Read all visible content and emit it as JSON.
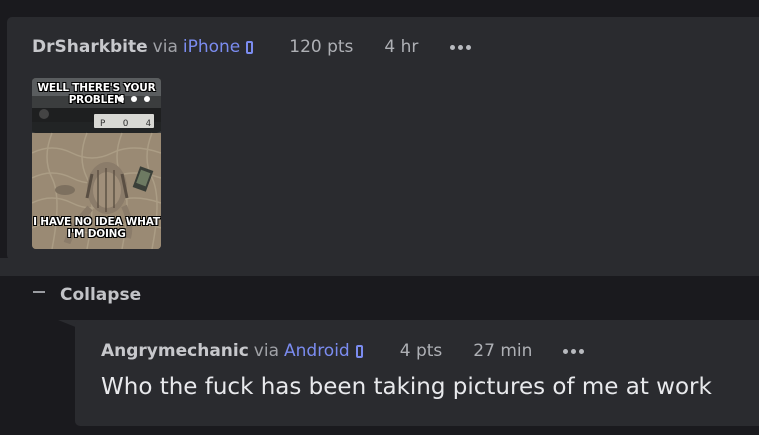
{
  "post": {
    "author": "DrSharkbite",
    "via": "via",
    "platform": "iPhone",
    "platform_icon": "phone-icon",
    "points": "120 pts",
    "time": "4 hr",
    "more_icon": "ellipsis-icon",
    "image": {
      "caption_top": "WELL THERE'S YOUR PROBLEM",
      "caption_bottom": "I HAVE NO IDEA WHAT I'M DOING",
      "plate_text": "P O 4"
    }
  },
  "collapse": {
    "icon": "minus-icon",
    "label": "Collapse"
  },
  "reply": {
    "author": "Angrymechanic",
    "via": "via",
    "platform": "Android",
    "platform_icon": "phone-icon",
    "points": "4 pts",
    "time": "27 min",
    "more_icon": "ellipsis-icon",
    "body": "Who the fuck has been taking pictures of me at work"
  },
  "colors": {
    "background": "#1a1a1e",
    "card": "#2a2b2f",
    "accent": "#7b8cf0"
  }
}
